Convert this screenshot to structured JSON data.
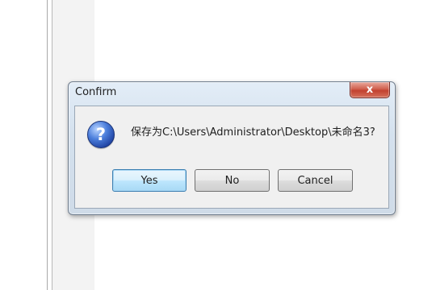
{
  "dialog": {
    "title": "Confirm",
    "close_label": "x",
    "icon": "question-icon",
    "icon_glyph": "?",
    "message": "保存为C:\\Users\\Administrator\\Desktop\\未命名3?",
    "buttons": {
      "yes": "Yes",
      "no": "No",
      "cancel": "Cancel"
    }
  },
  "colors": {
    "frame": "#d4e1ee",
    "close_button": "#c2412f",
    "default_button": "#bee6fd",
    "icon": "#2f5fc6"
  }
}
